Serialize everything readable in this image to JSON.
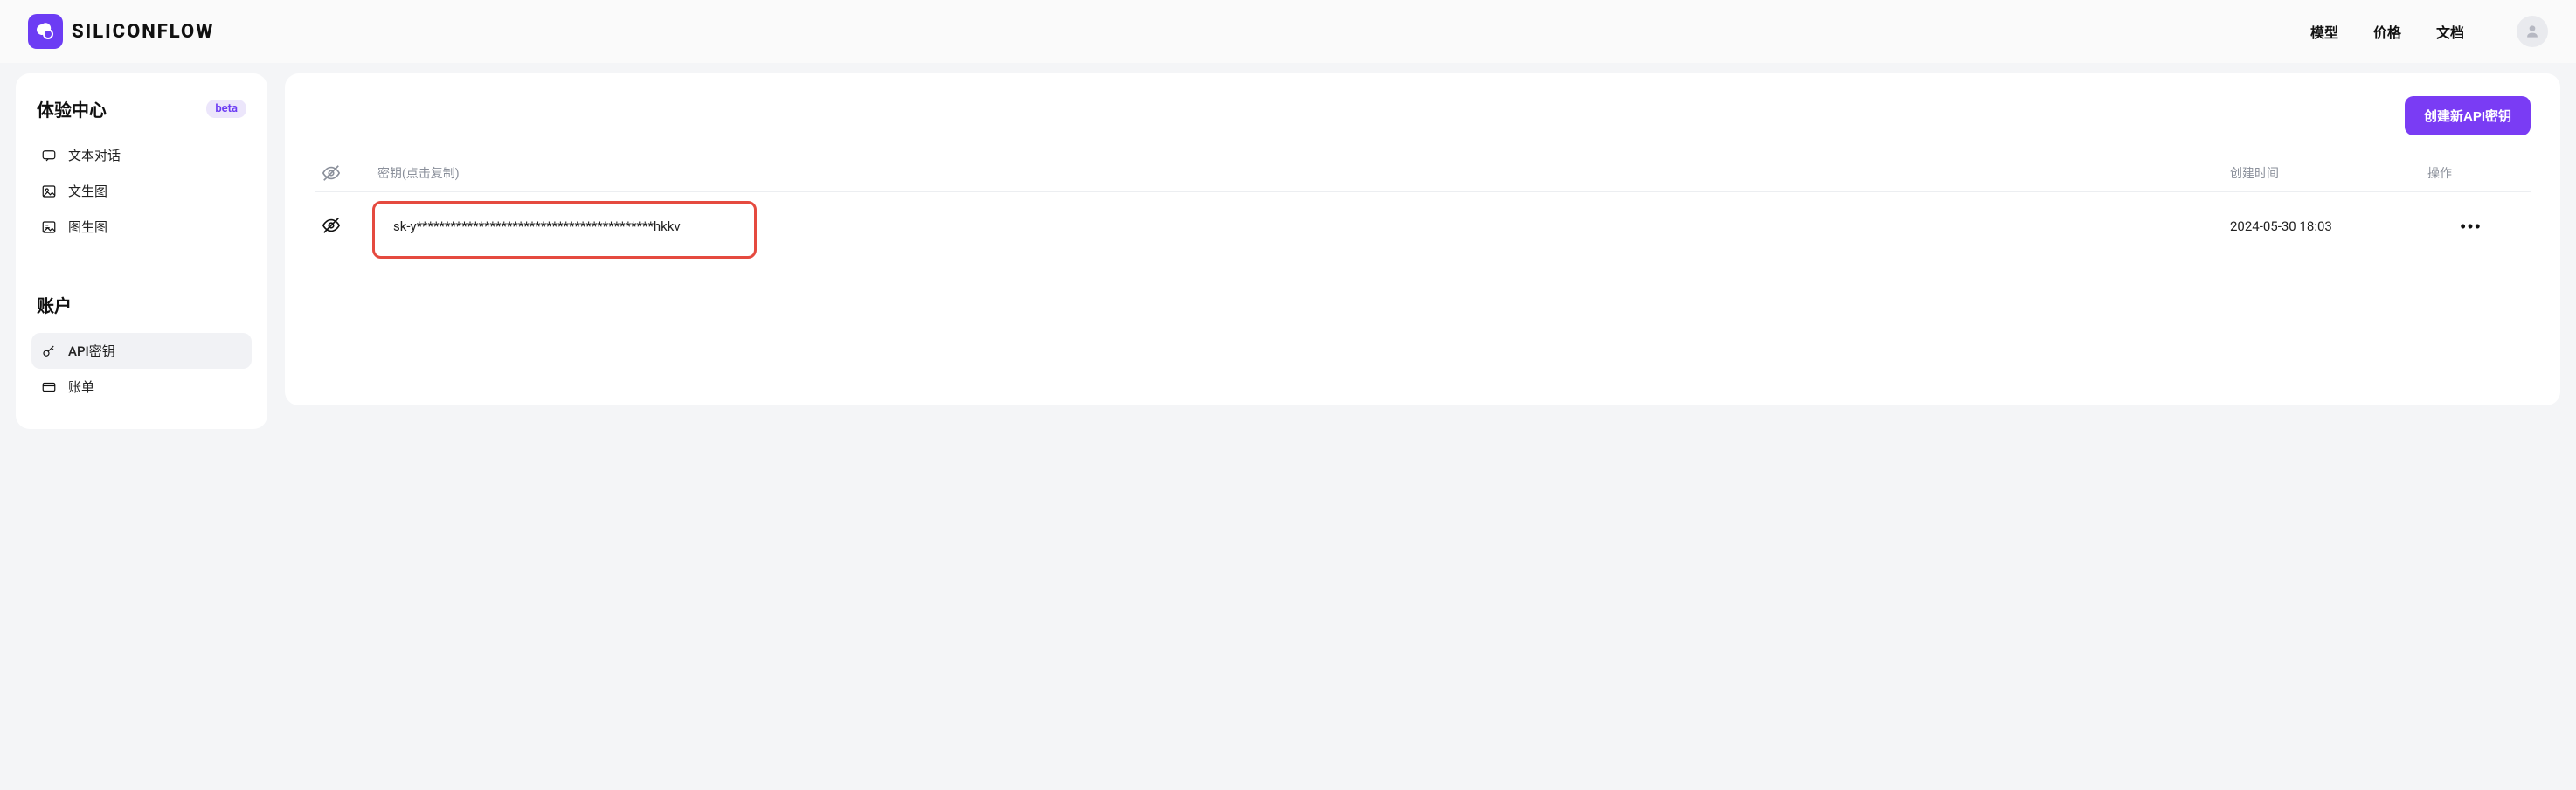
{
  "brand": {
    "name": "SILICONFLOW"
  },
  "header": {
    "nav": [
      {
        "label": "模型"
      },
      {
        "label": "价格"
      },
      {
        "label": "文档"
      }
    ]
  },
  "sidebar": {
    "experience": {
      "title": "体验中心",
      "badge": "beta",
      "items": [
        {
          "icon": "chat-icon",
          "label": "文本对话"
        },
        {
          "icon": "image-icon",
          "label": "文生图"
        },
        {
          "icon": "img2img-icon",
          "label": "图生图"
        }
      ]
    },
    "account": {
      "title": "账户",
      "items": [
        {
          "icon": "key-icon",
          "label": "API密钥",
          "active": true
        },
        {
          "icon": "card-icon",
          "label": "账单"
        }
      ]
    }
  },
  "main": {
    "create_button": "创建新API密钥",
    "columns": {
      "key": "密钥(点击复制)",
      "created": "创建时间",
      "action": "操作"
    },
    "rows": [
      {
        "masked_key": "sk-y******************************************hkkv",
        "created_at": "2024-05-30 18:03"
      }
    ]
  }
}
